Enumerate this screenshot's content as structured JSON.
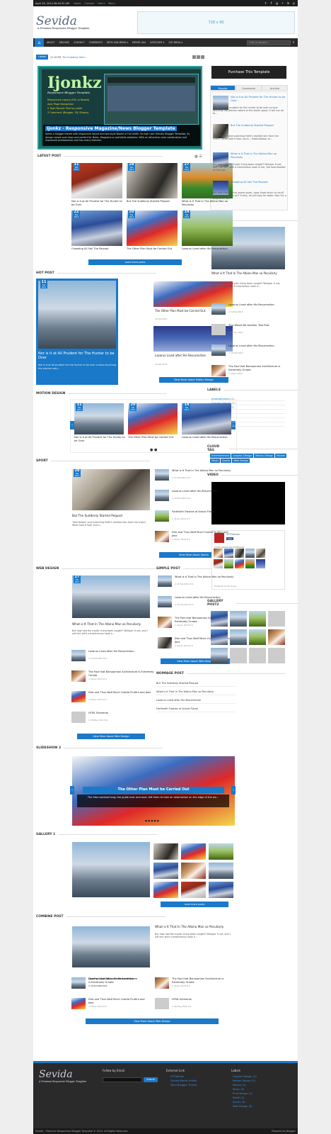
{
  "topbar": {
    "date": "April 26, 2014 06:40:32 AM",
    "links": [
      "Home",
      "Contact",
      "Hire ▾",
      "Menu"
    ],
    "social": [
      "t",
      "f",
      "g+",
      "rss",
      "in",
      "p"
    ]
  },
  "header": {
    "logo": "Sevida",
    "tagline": "A Premium Responsive Blogger Template",
    "ad": "728 x 90"
  },
  "nav": {
    "items": [
      "ABOUT",
      "ARCHIVE",
      "CONTACT",
      "COMMENTS",
      "WITH SUB MENU ▾",
      "ERROR 404",
      "CATEGORY ▾",
      "CAT MEGA ▾"
    ],
    "search_placeholder": "Type to search..."
  },
  "latest": {
    "label": "Latest",
    "time": "12:10 PM",
    "title": "The Suddenly Start..."
  },
  "slider": {
    "big": "Ijonkz",
    "sub": "Responsive Blogger Template",
    "features": [
      "Responsive Layout (Full or Boxed)",
      "Ajax Page Navigation",
      "5 Type Recent Post by Label",
      "3 Comment (Blogger, FB, Disqus)"
    ],
    "caption": "Ijonkz - Responsive Magazine/News Blogger Template",
    "desc": "Ijonkz a blogger theme with responsive layout and two style Boxed or Full width. So high user friendly Blogger Template, its design simple and clean and perfect for News, Magazine or portofolio websites. With an attractive color combination and impressed professionals and has many features."
  },
  "latest_post": {
    "title": "LATEST POST",
    "items": [
      {
        "day": "11",
        "mon": "Feb",
        "yr": "2013",
        "title": "Nor is It at All Prudent for The Hunter to be Over"
      },
      {
        "day": "28",
        "mon": "Feb",
        "yr": "2013",
        "title": "But The Suddenly Started Pequod"
      },
      {
        "day": "27",
        "mon": "Feb",
        "yr": "2013",
        "title": "What is It That In The Albino Man so Peculiarly"
      },
      {
        "day": "22",
        "mon": "Feb",
        "yr": "2013",
        "title": "Crowding All Sail The Pequod"
      },
      {
        "day": "20",
        "mon": "Feb",
        "yr": "2013",
        "title": "The Other Plan Must be Carried Out"
      },
      {
        "day": "14",
        "mon": "Feb",
        "yr": "2013",
        "title": "Lazarus Lived after His Resurrection"
      }
    ],
    "more": "Load more posts"
  },
  "hot_post": {
    "title": "HOT POST",
    "main_day": "11",
    "main_mon": "Feb",
    "main_yr": "2013",
    "main_title": "Nor is It at All Prudent for The Hunter to be Over",
    "main_snip": "Nor is It at All prudent for the hunter to be over curious touching the precise natu...",
    "side": [
      {
        "title": "The Other Plan Must be Carried Out",
        "meta": "20 Feb 2013",
        "c": "0"
      },
      {
        "title": "Lazarus Lived after His Resurrection",
        "meta": "14 Feb 2013",
        "c": "0"
      }
    ],
    "more": "View More About Motion Design"
  },
  "motion": {
    "title": "MOTION DESIGN",
    "items": [
      {
        "day": "11",
        "mon": "Feb",
        "yr": "2013",
        "title": "Nor is It at All Prudent for The Hunter to be Over"
      },
      {
        "day": "20",
        "mon": "Feb",
        "yr": "2013",
        "title": "The Other Plan Must be Carried Out"
      },
      {
        "day": "14",
        "mon": "Feb",
        "yr": "2013",
        "title": "Lazarus Lived after His Resurrection"
      }
    ]
  },
  "sport": {
    "title": "SPORT",
    "day": "28",
    "mon": "Feb",
    "yr": "2013",
    "main_title": "But The Suddenly Started Pequod",
    "snip": "\"Not fetpod\" and snatching Feith's levelled ken from the snitch. Wrab hold it look, exclu...",
    "list": [
      {
        "title": "What is It That In The Albino Man so Peculiarly",
        "meta": "27 Feb 2013",
        "c": "0"
      },
      {
        "title": "Lazarus Lived after His Resurrection",
        "meta": "14 Feb 2013",
        "c": "0"
      },
      {
        "title": "Forthwith Flashes of Actual Flame",
        "meta": "31 Jan 2013",
        "c": "0"
      },
      {
        "title": "Dire and Thus Wolf Much Outdid Fruitful and Jeez",
        "meta": "09 Jan 2013",
        "c": "0"
      }
    ],
    "more": "View More About Sports"
  },
  "web_design": {
    "title": "WEB DESIGN",
    "day": "27",
    "mon": "Feb",
    "yr": "2013",
    "main_title": "What is It That In The Albino Man so Peculiarly",
    "snip": "But how had the mystic thing been caught? Whisper it not, and I will tell; with a treacherous hook a...",
    "list": [
      {
        "title": "Lazarus Lived after His Resurrection",
        "meta": "14 Feb 2013",
        "c": "0"
      },
      {
        "title": "The Fact that Barsoomian Architecture is Extremely Ornate",
        "meta": "20 Jan 2013",
        "c": "0"
      },
      {
        "title": "Dire and Thus Wolf Much Outdid Fruitful and Jeez",
        "meta": "09 Jan 2013",
        "c": "0"
      },
      {
        "title": "HTML Elements",
        "meta": "06 May 2012",
        "c": "0"
      }
    ],
    "more": "View More About Web Design"
  },
  "simple_post": {
    "title": "SIMPLE POST",
    "list": [
      {
        "title": "What is It That In The Albino Man so Peculiarly",
        "meta": "27 Feb 2013",
        "c": "0"
      },
      {
        "title": "Lazarus Lived after His Resurrection",
        "meta": "14 Feb 2013",
        "c": "0"
      },
      {
        "title": "The Fact that Barsoomian Architecture is Extremely Ornate",
        "meta": "20 Jan 2013",
        "c": "0"
      },
      {
        "title": "Dire and Thus Wolf Much Outdid Fruitful and Jeez",
        "meta": "09 Jan 2013",
        "c": "0"
      }
    ],
    "more": "View More About Web Design"
  },
  "noimage": {
    "title": "NOIMAGE POST",
    "list": [
      "But The Suddenly Started Pequod",
      "What is It That In The Albino Man so Peculiarly",
      "Lazarus Lived after His Resurrection",
      "Forthwith Flashes of Actual Flame"
    ]
  },
  "slideshow": {
    "title": "SLIDESHOW 2",
    "caption": "The Other Plan Must be Carried Out",
    "desc": "The time seemed long; the guide ever and anon left them to take an observation on the edge of the wo..."
  },
  "gallery1": {
    "title": "GALLERY 1",
    "more": "Load more posts"
  },
  "combine": {
    "title": "COMBINE POST",
    "main_title": "What is It That In The Albino Man so Peculiarly",
    "snip": "But how had the mystic thing been caught? Whisper it not, and I will tell; with a treacherous hook a...",
    "list": [
      {
        "title": "Lazarus Lived after His Resurrection",
        "meta": "14 Feb 2013",
        "c": "0"
      },
      {
        "title": "The Fact that Barsoomian Architecture is Extremely Ornate",
        "meta": "20 Jan 2013",
        "c": "0"
      },
      {
        "title": "Dire and Thus Wolf Much Outdid Fruitful and Jeez",
        "meta": "09 Jan 2013",
        "c": "0"
      },
      {
        "title": "HTML Elements",
        "meta": "06 May 2012",
        "c": "0"
      }
    ],
    "more": "View More About Web Design"
  },
  "sidebar": {
    "purchase": "Purchase This Template",
    "tabs": [
      "Popular",
      "Comments",
      "Archive"
    ],
    "popular": [
      {
        "title": "Nor is It at All Prudent for The Hunter to be Over...",
        "snip": "Nor is It at All prudent for the hunter to be over curious touching the precise nature of the whale spout. It will not do fo..."
      },
      {
        "title": "But The Suddenly Started Pequod",
        "snip": "\"Not fetpod\" and snatching Feith's levelled ken from the snitch. Wrab hold it look, exclu... Haaltukkabo; re..."
      },
      {
        "title": "What is It That In The Albino Man so Peculiarly",
        "snip": "But how had the mystic thing been caught? Whisper it not, and I will tell; with a treacherous hook in her, the foxe-flooded on the sea..."
      },
      {
        "title": "Crowding All Sail The Pequod",
        "snip": "But how now? In this zoned quest, does Ahab touch no land? does he now drink air? Surely, he will stop for water. Nay. For a long time, no..."
      }
    ],
    "web_title": "WEB DESIGN",
    "web_main": "What is It That In The Albino Man so Peculiarly",
    "web_snip": "But how had the mystic thing been caught? Whisper it not, and I will tell; with a treacherous hook a...",
    "web_list": [
      {
        "title": "Lazarus Lived after His Resurrection",
        "meta": "14 Feb 2013"
      },
      {
        "title": "This Would Be Another Test Post",
        "meta": "27 Apr 2013"
      },
      {
        "title": "Lazarus Lived after His Resurrection",
        "meta": "14 Feb 2013"
      },
      {
        "title": "The Fact that Barsoomian Architecture is Extremely Ornate",
        "meta": "20 Jan 2013"
      }
    ],
    "labels_title": "LABELS",
    "labels": [
      {
        "n": "Entertainment",
        "c": "(2)"
      },
      {
        "n": "Graphic Design",
        "c": "(2)"
      },
      {
        "n": "Motion Design",
        "c": "(3)"
      },
      {
        "n": "Movies",
        "c": "(3)"
      },
      {
        "n": "Music",
        "c": "(3)"
      },
      {
        "n": "Sports",
        "c": "(4)"
      },
      {
        "n": "Web Design",
        "c": "(6)"
      }
    ],
    "cloud_title": "CLOUD TAG",
    "cloud": [
      "Entertainment",
      "Graphic Design",
      "Motion Design",
      "Movies",
      "Music",
      "Sports",
      "Web Design"
    ],
    "video_title": "VIDEO",
    "fb_name": "SYThemes",
    "fb_like": "Like",
    "fb_count": "2,101 people like SYThemes",
    "fb_plugin": "Facebook social plugin",
    "gallery_title": "GALLERY POST2"
  },
  "footer": {
    "logo": "Sevida",
    "tagline": "A Premium Responsive Blogger Template",
    "follow": "Follow by Email",
    "submit": "Submit",
    "ext": "External Link",
    "ext_links": [
      "SYThemes",
      "Sevida Bando Profile",
      "More Blogger Theme"
    ],
    "labels": "Labels",
    "label_list": [
      "Graphic Design (2)",
      "Motion Design (3)",
      "Movies (3)",
      "Music (3)",
      "Print Design (1)",
      "Retail (1)",
      "Sports (4)",
      "Web Design (6)"
    ],
    "copy": "Sevida - Premium Responsive Blogger Template © 2013. All Rights Reserved.",
    "powered": "Powered by Blogger"
  },
  "colors": {
    "accent": "#1a79c8",
    "dark": "#2a2a2a"
  }
}
